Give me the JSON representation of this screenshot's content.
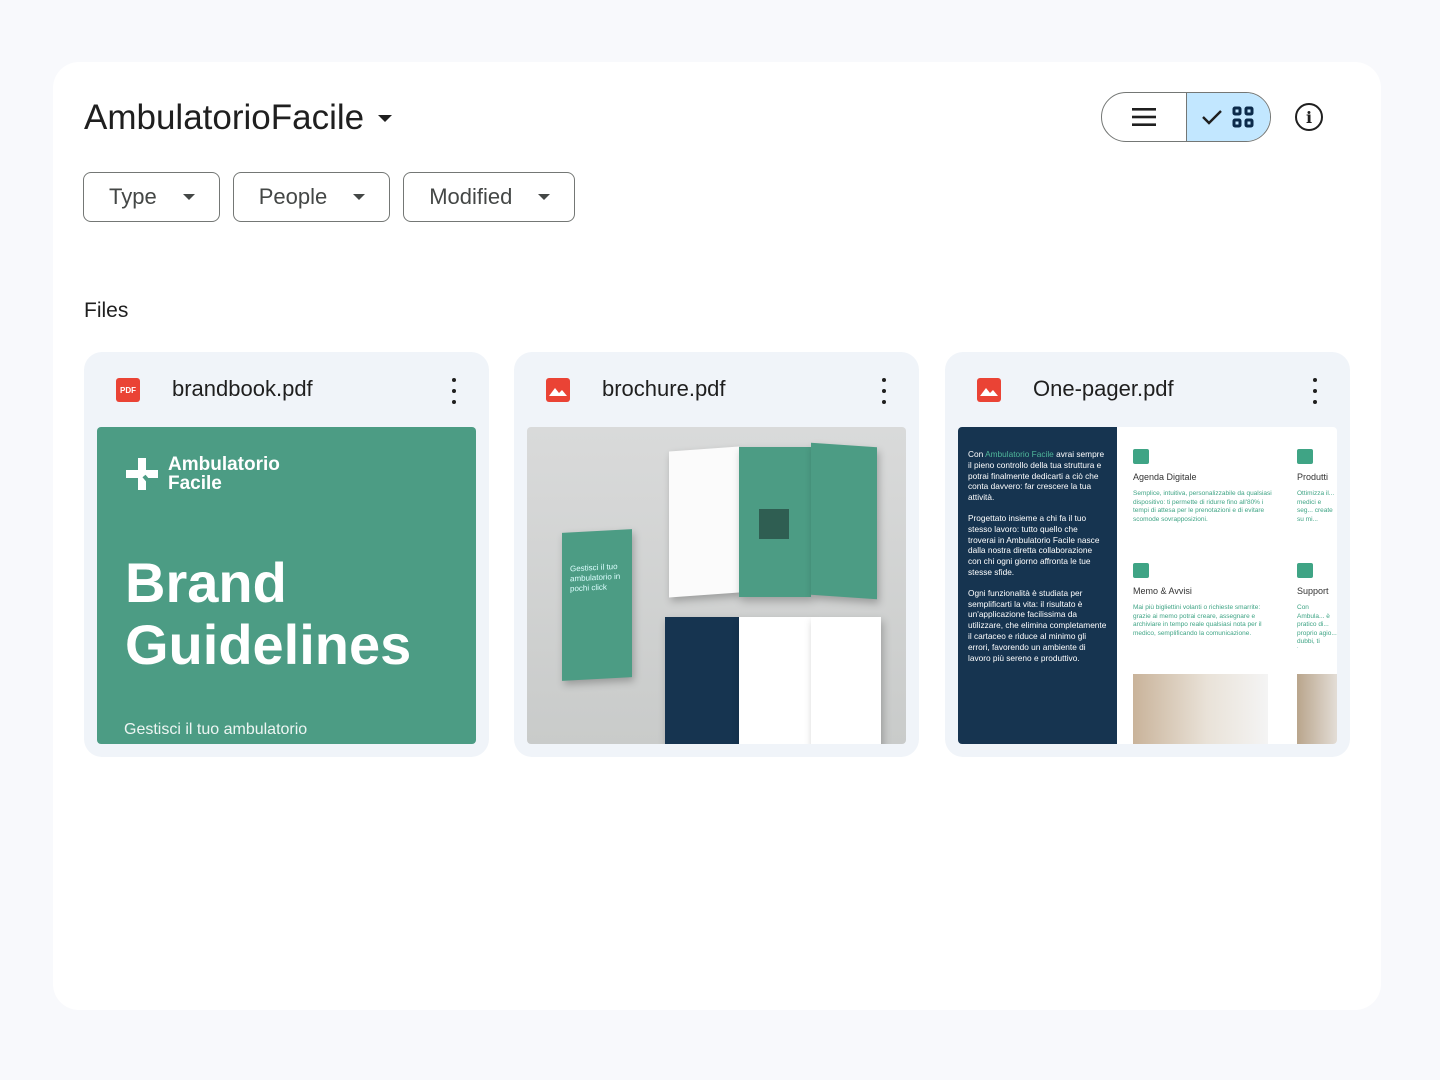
{
  "header": {
    "title": "AmbulatorioFacile",
    "view_toggle": {
      "list_icon": "list-icon",
      "grid_icon": "grid-icon",
      "selected": "grid"
    },
    "info_icon": "info-icon"
  },
  "filters": [
    {
      "label": "Type"
    },
    {
      "label": "People"
    },
    {
      "label": "Modified"
    }
  ],
  "section": {
    "label": "Files"
  },
  "files": [
    {
      "name": "brandbook.pdf",
      "type_icon": "pdf-icon",
      "type_badge": "PDF",
      "thumbnail": {
        "logo": "Ambulatorio\nFacile",
        "logo_line1": "Ambulatorio",
        "logo_line2": "Facile",
        "title_line1": "Brand",
        "title_line2": "Guidelines",
        "subtitle": "Gestisci il tuo ambulatorio"
      }
    },
    {
      "name": "brochure.pdf",
      "type_icon": "image-icon",
      "thumbnail": {
        "panel_text": "Gestisci il tuo ambulatorio in pochi click"
      }
    },
    {
      "name": "One-pager.pdf",
      "type_icon": "image-icon",
      "thumbnail": {
        "p1_pre": "Con ",
        "p1_hl": "Ambulatorio Facile",
        "p1_post": " avrai sempre il pieno controllo della tua struttura e potrai finalmente dedicarti a ciò che conta davvero: far crescere la tua attività.",
        "p2": "Progettato insieme a chi fa il tuo stesso lavoro: tutto quello che troverai in Ambulatorio Facile nasce dalla nostra diretta collaborazione con chi ogni giorno affronta le tue stesse sfide.",
        "p3": "Ogni funzionalità è studiata per semplificarti la vita: il risultato è un'applicazione facilissima da utilizzare, che elimina completamente il cartaceo e riduce al minimo gli errori, favorendo un ambiente di lavoro più sereno e produttivo.",
        "features": [
          {
            "title": "Agenda Digitale",
            "desc": "Semplice, intuitiva, personalizzabile da qualsiasi dispositivo: ti permette di ridurre fino all'80% i tempi di attesa per le prenotazioni e di evitare scomode sovrapposizioni."
          },
          {
            "title": "Produtti",
            "desc": "Ottimizza il... medici e seg... create su mi... maggior col..."
          },
          {
            "title": "Memo & Avvisi",
            "desc": "Mai più bigliettini volanti o richieste smarrite: grazie ai memo potrai creare, assegnare e archiviare in tempo reale qualsiasi nota per il medico, semplificando la comunicazione."
          },
          {
            "title": "Support",
            "desc": "Con Ambula... è pratico di... proprio agio... dubbi, ti bas... sempre disp... ulteriori cost..."
          }
        ]
      }
    }
  ],
  "colors": {
    "brand_green": "#4c9c84",
    "navy": "#163450",
    "toggle_selected": "#c2e7ff",
    "file_red": "#ea4335"
  }
}
